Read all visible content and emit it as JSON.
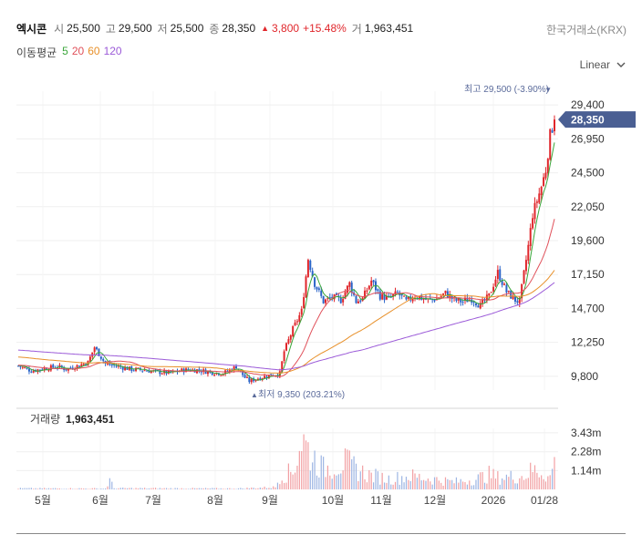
{
  "header": {
    "name": "엑시콘",
    "open_label": "시",
    "open": "25,500",
    "high_label": "고",
    "high": "29,500",
    "low_label": "저",
    "low": "25,500",
    "close_label": "종",
    "close": "28,350",
    "change_arrow": "▲",
    "change": "3,800",
    "change_pct": "+15.48%",
    "volume_label": "거",
    "volume": "1,963,451",
    "exchange": "한국거래소(KRX)"
  },
  "moving_average": {
    "label": "이동평균",
    "periods": [
      {
        "value": "5",
        "color": "#3aa63a"
      },
      {
        "value": "20",
        "color": "#e0505a"
      },
      {
        "value": "60",
        "color": "#e8902a"
      },
      {
        "value": "120",
        "color": "#9b5ad8"
      }
    ]
  },
  "scale_mode": "Linear",
  "annotations": {
    "high_label": "최고 29,500 (-3.90%)",
    "high_marker": "▼",
    "low_label": "최저 9,350 (203.21%)",
    "low_marker": "▲",
    "current_price": "28,350"
  },
  "volume_panel": {
    "label": "거래량",
    "value": "1,963,451",
    "ticks": [
      {
        "v": 3430000,
        "t": "3.43m"
      },
      {
        "v": 2280000,
        "t": "2.28m"
      },
      {
        "v": 1140000,
        "t": "1.14m"
      }
    ]
  },
  "colors": {
    "up": "#e0262b",
    "down": "#2a64c8",
    "accent": "#5b6b9b",
    "price_tag": "#4a5f93"
  },
  "chart_data": {
    "type": "candlestick",
    "y_ticks": [
      29400,
      26950,
      24500,
      22050,
      19600,
      17150,
      14700,
      12250,
      9800
    ],
    "y_tick_labels": [
      "29,400",
      "26,950",
      "24,500",
      "22,050",
      "19,600",
      "17,150",
      "14,700",
      "12,250",
      "9,800"
    ],
    "x_tick_labels": [
      "5월",
      "6월",
      "7월",
      "8월",
      "9월",
      "10월",
      "11월",
      "12월",
      "2026",
      "01/28"
    ],
    "ylim": [
      8800,
      30400
    ],
    "price_waypoints": [
      [
        0,
        10550
      ],
      [
        6,
        10200
      ],
      [
        12,
        10350
      ],
      [
        18,
        10500
      ],
      [
        22,
        10300
      ],
      [
        28,
        10600
      ],
      [
        32,
        10800
      ],
      [
        35,
        11900
      ],
      [
        40,
        10700
      ],
      [
        46,
        10500
      ],
      [
        52,
        10300
      ],
      [
        58,
        10250
      ],
      [
        64,
        10100
      ],
      [
        70,
        10050
      ],
      [
        76,
        10250
      ],
      [
        82,
        10250
      ],
      [
        88,
        10100
      ],
      [
        94,
        10000
      ],
      [
        100,
        10500
      ],
      [
        104,
        9700
      ],
      [
        106,
        9450
      ],
      [
        110,
        9650
      ],
      [
        116,
        9900
      ],
      [
        120,
        10000
      ],
      [
        122,
        11600
      ],
      [
        126,
        13200
      ],
      [
        130,
        14500
      ],
      [
        133,
        18300
      ],
      [
        136,
        16500
      ],
      [
        140,
        15200
      ],
      [
        144,
        15500
      ],
      [
        148,
        15300
      ],
      [
        152,
        16500
      ],
      [
        155,
        15200
      ],
      [
        158,
        15400
      ],
      [
        162,
        16700
      ],
      [
        166,
        15600
      ],
      [
        170,
        15400
      ],
      [
        174,
        15800
      ],
      [
        178,
        15200
      ],
      [
        182,
        15600
      ],
      [
        188,
        15300
      ],
      [
        192,
        15400
      ],
      [
        196,
        15800
      ],
      [
        200,
        15300
      ],
      [
        204,
        15200
      ],
      [
        208,
        15400
      ],
      [
        212,
        14900
      ],
      [
        216,
        15600
      ],
      [
        220,
        17300
      ],
      [
        224,
        15900
      ],
      [
        228,
        15300
      ],
      [
        230,
        15200
      ],
      [
        232,
        17200
      ],
      [
        234,
        19200
      ],
      [
        236,
        21500
      ],
      [
        238,
        22500
      ],
      [
        240,
        23500
      ],
      [
        242,
        24700
      ],
      [
        244,
        27200
      ],
      [
        246,
        28350
      ]
    ],
    "ma_end_values": {
      "ma5": 25200,
      "ma20": 19400,
      "ma60": 16600,
      "ma120": 14600
    },
    "volume_waypoints": [
      [
        0,
        70000
      ],
      [
        40,
        60000
      ],
      [
        42,
        600000
      ],
      [
        44,
        80000
      ],
      [
        100,
        60000
      ],
      [
        118,
        150000
      ],
      [
        120,
        900000
      ],
      [
        126,
        1200000
      ],
      [
        130,
        3430000
      ],
      [
        134,
        2400000
      ],
      [
        140,
        1400000
      ],
      [
        150,
        1800000
      ],
      [
        160,
        1000000
      ],
      [
        170,
        700000
      ],
      [
        180,
        900000
      ],
      [
        200,
        500000
      ],
      [
        210,
        700000
      ],
      [
        216,
        1000000
      ],
      [
        220,
        800000
      ],
      [
        232,
        900000
      ],
      [
        236,
        1300000
      ],
      [
        240,
        1200000
      ],
      [
        244,
        800000
      ],
      [
        246,
        1963451
      ]
    ]
  }
}
